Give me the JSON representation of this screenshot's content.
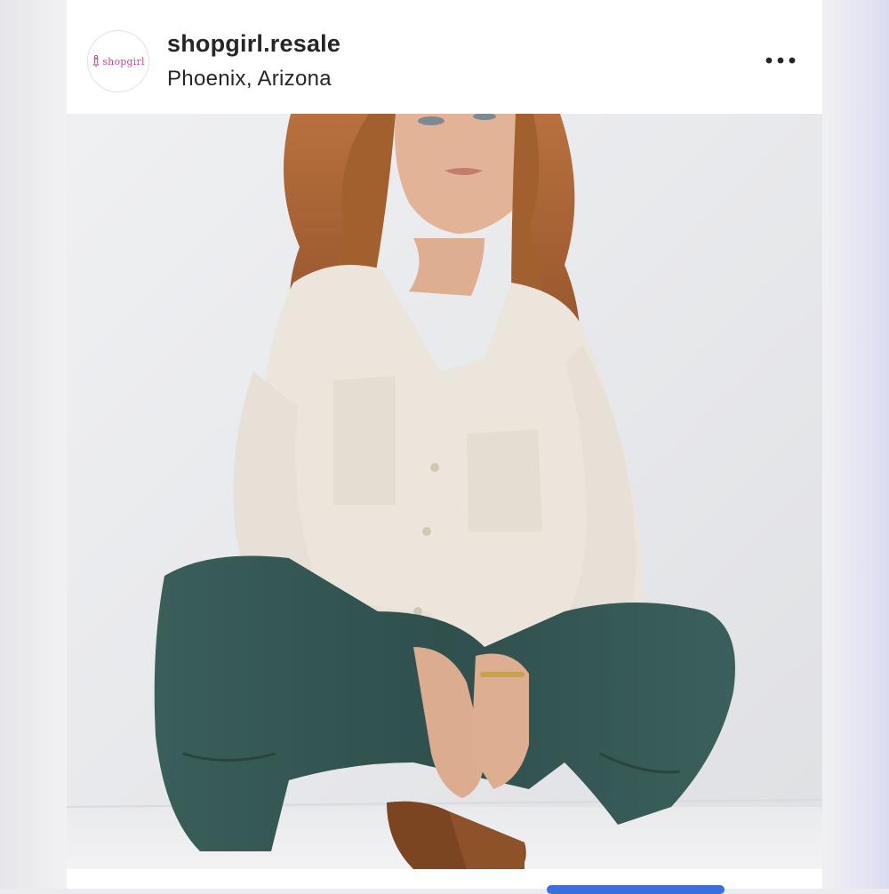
{
  "post": {
    "avatar_text": "shopgirl",
    "username": "shopgirl.resale",
    "location": "Phoenix, Arizona"
  },
  "photo": {
    "subject": "woman-in-cream-shirt-and-teal-pants"
  },
  "icons": {
    "more": "more-horizontal-icon",
    "avatar_logo": "dress-form-icon"
  },
  "colors": {
    "brand_pink": "#d2439a",
    "text": "#262626",
    "accent_blue": "#3b6fe0"
  }
}
